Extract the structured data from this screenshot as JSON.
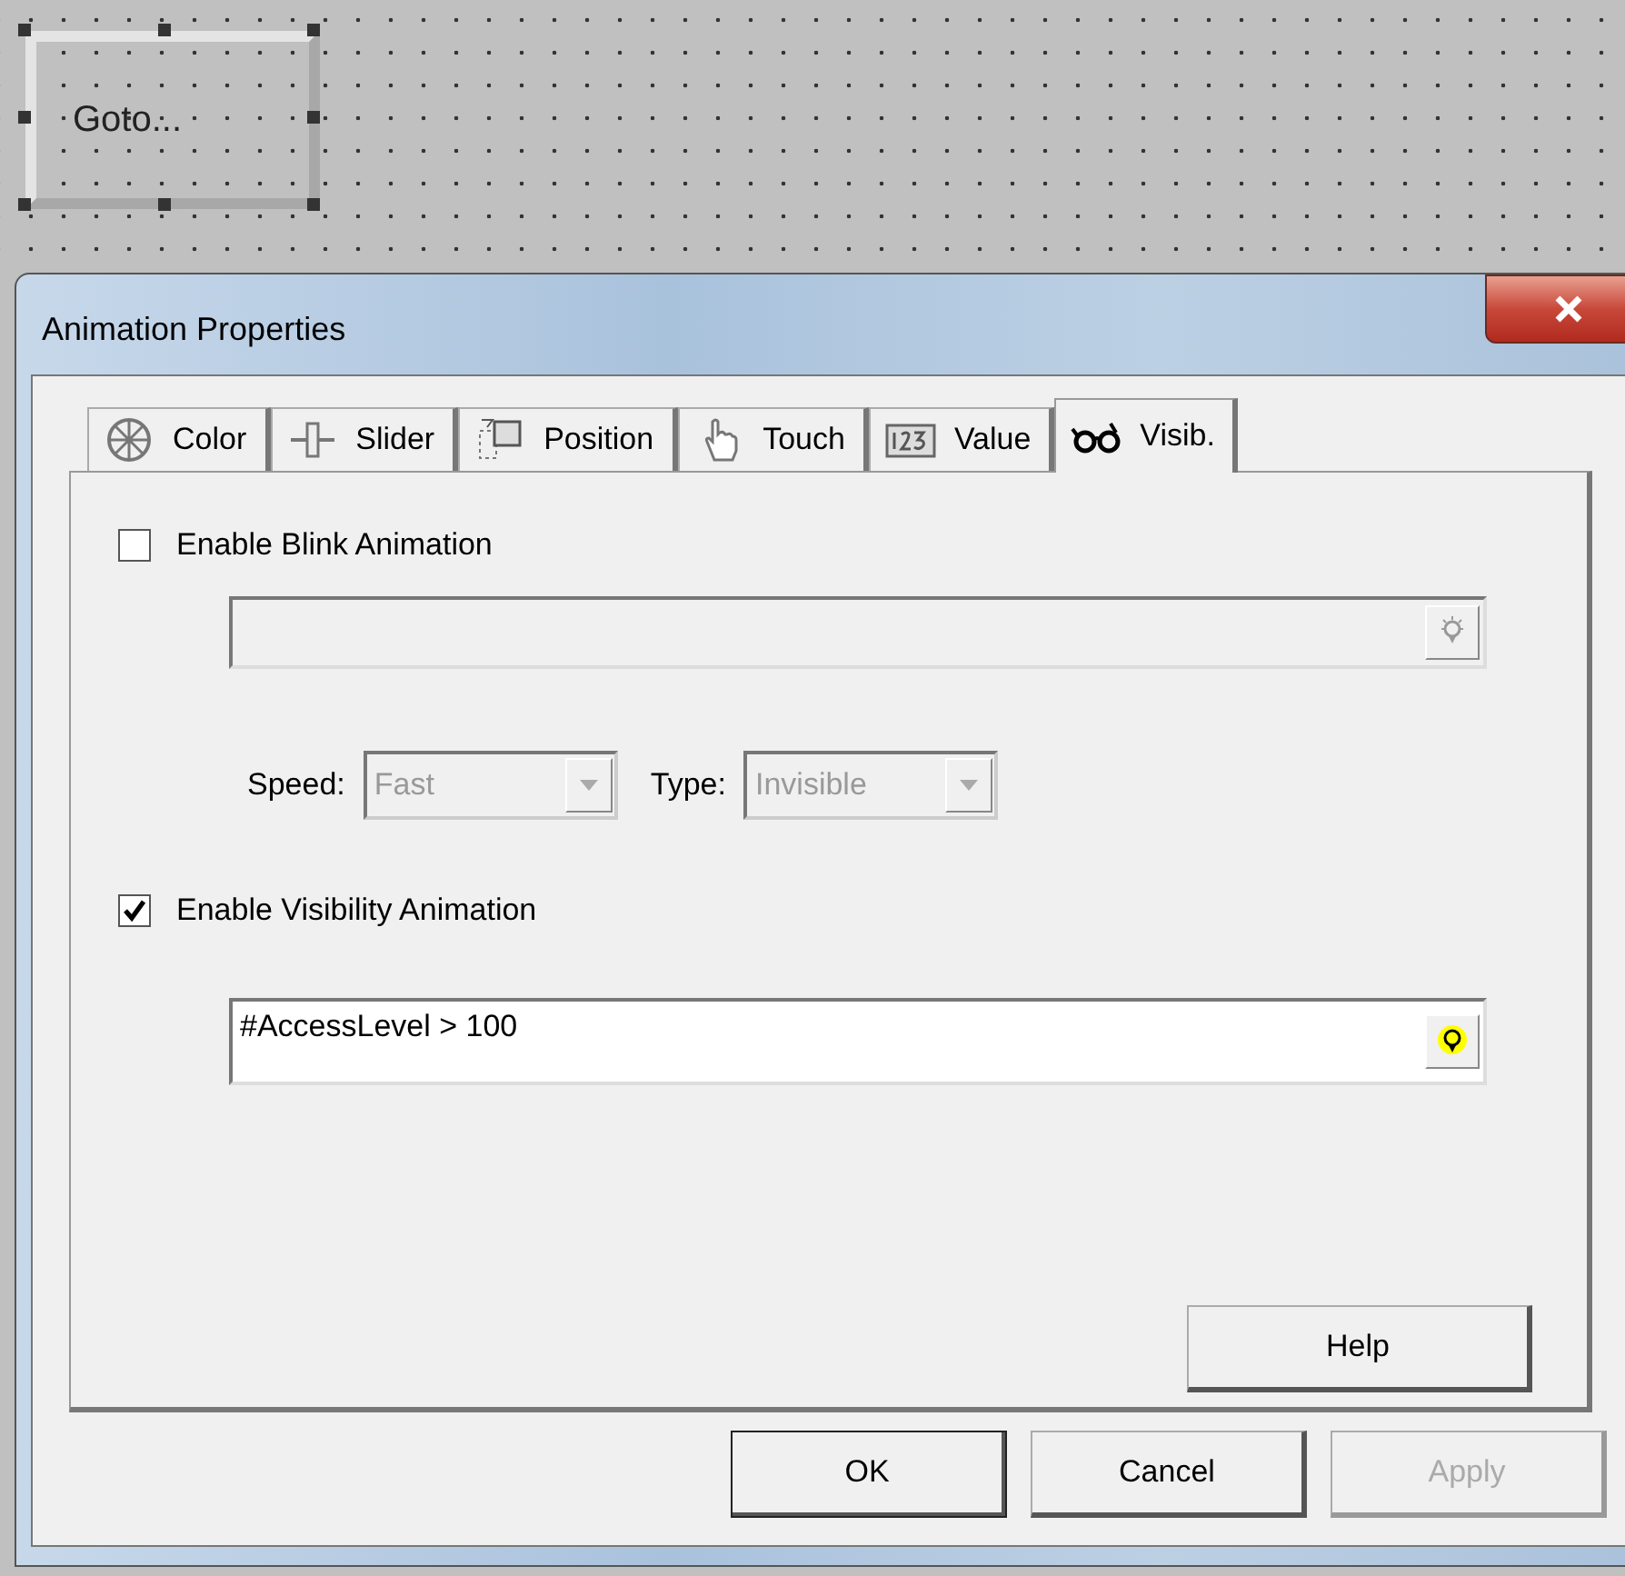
{
  "canvas": {
    "widget": {
      "label": "Goto...",
      "selected": true
    }
  },
  "dialog": {
    "title": "Animation Properties",
    "tabs": [
      {
        "label": "Color",
        "kind": "wheel",
        "selected": false
      },
      {
        "label": "Slider",
        "kind": "slider",
        "selected": false
      },
      {
        "label": "Position",
        "kind": "position",
        "selected": false
      },
      {
        "label": "Touch",
        "kind": "hand",
        "selected": false
      },
      {
        "label": "Value",
        "kind": "number",
        "selected": false
      },
      {
        "label": "Visib.",
        "kind": "glasses",
        "selected": true
      }
    ],
    "blink": {
      "label": "Enable Blink Animation",
      "checked": false,
      "expression": {
        "disabled": true
      },
      "speed": {
        "label": "Speed:",
        "value": "Fast",
        "disabled": true
      },
      "type": {
        "label": "Type:",
        "value": "Invisible",
        "disabled": true
      }
    },
    "visibility": {
      "label": "Enable Visibility Animation",
      "checked": true,
      "expression": {
        "value": "#AccessLevel > 100",
        "disabled": false
      }
    },
    "help_button": "Help",
    "buttons": [
      {
        "label": "OK",
        "disabled": false,
        "default": true
      },
      {
        "label": "Cancel",
        "disabled": false,
        "default": false
      },
      {
        "label": "Apply",
        "disabled": true,
        "default": false
      }
    ]
  }
}
